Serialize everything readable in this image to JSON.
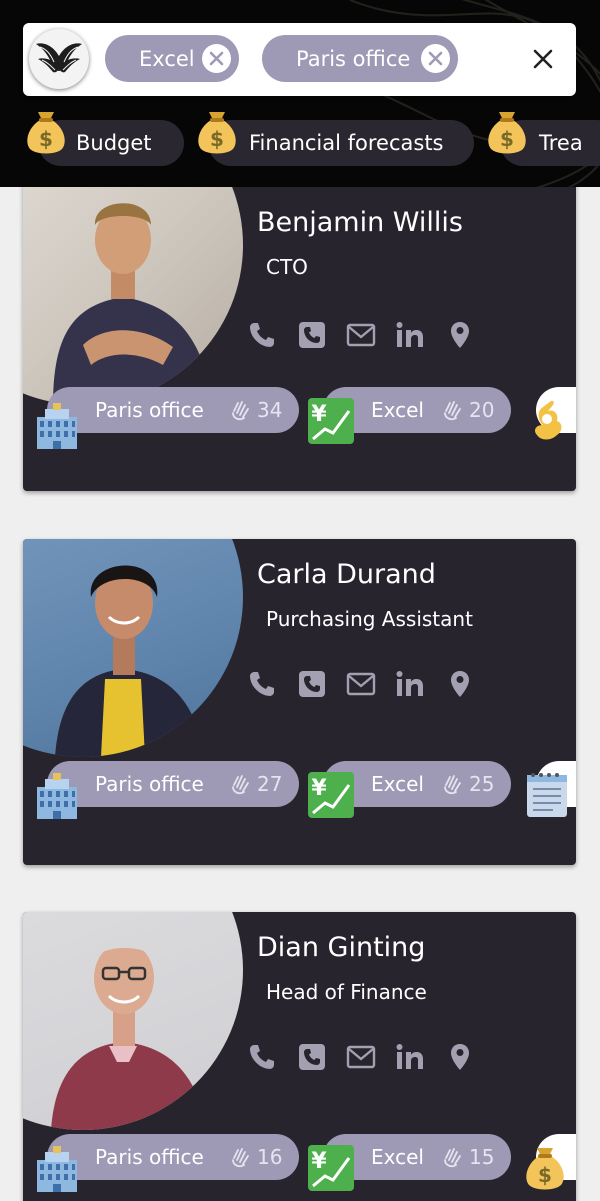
{
  "search": {
    "filters": [
      {
        "label": "Excel"
      },
      {
        "label": "Paris office"
      }
    ]
  },
  "tags": [
    {
      "label": "Budget",
      "icon": "money-bag-icon"
    },
    {
      "label": "Financial forecasts",
      "icon": "money-bag-icon"
    },
    {
      "label": "Trea",
      "icon": "money-bag-icon"
    }
  ],
  "people": [
    {
      "name": "Benjamin Willis",
      "role": "CTO",
      "skills": [
        {
          "label": "Paris office",
          "count": "34",
          "icon": "office-building-icon"
        },
        {
          "label": "Excel",
          "count": "20",
          "icon": "chart-yen-icon"
        }
      ],
      "extra_icon": "ok-hand-icon"
    },
    {
      "name": "Carla Durand",
      "role": "Purchasing Assistant",
      "skills": [
        {
          "label": "Paris office",
          "count": "27",
          "icon": "office-building-icon"
        },
        {
          "label": "Excel",
          "count": "25",
          "icon": "chart-yen-icon"
        }
      ],
      "extra_icon": "notepad-icon"
    },
    {
      "name": "Dian Ginting",
      "role": "Head of Finance",
      "skills": [
        {
          "label": "Paris office",
          "count": "16",
          "icon": "office-building-icon"
        },
        {
          "label": "Excel",
          "count": "15",
          "icon": "chart-yen-icon"
        }
      ],
      "extra_icon": "money-bag-icon"
    }
  ],
  "colors": {
    "header_bg": "#060606",
    "chip_bg": "#9e9ab6",
    "card_bg": "#27242e",
    "tag_bg": "#2a2730",
    "page_bg": "#efefef"
  }
}
